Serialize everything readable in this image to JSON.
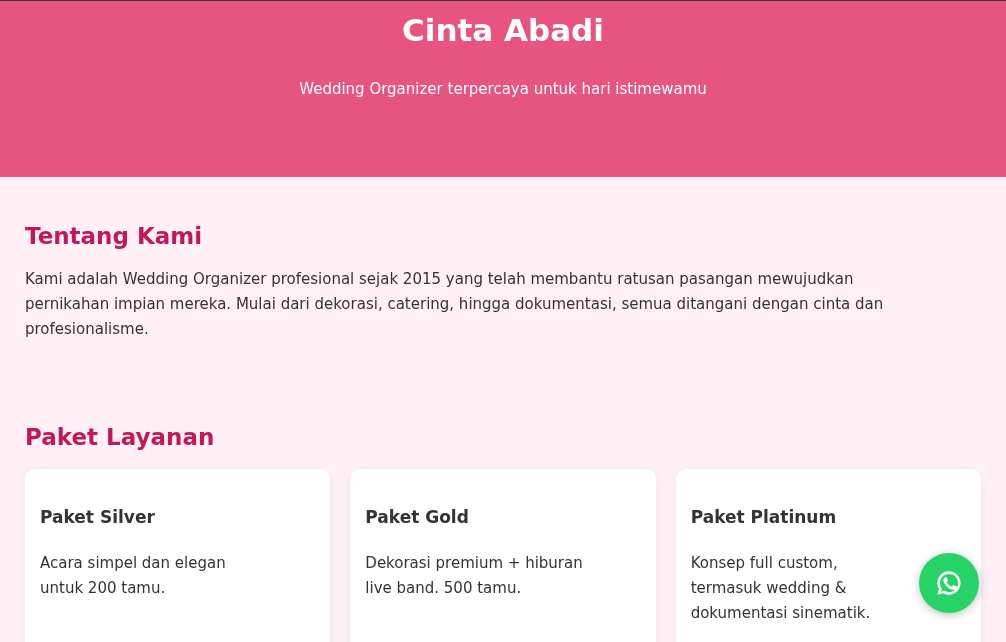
{
  "header": {
    "title": "Cinta Abadi",
    "tagline": "Wedding Organizer terpercaya untuk hari istimewamu"
  },
  "about": {
    "heading": "Tentang Kami",
    "text": "Kami adalah Wedding Organizer profesional sejak 2015 yang telah membantu ratusan pasangan mewujudkan pernikahan impian mereka. Mulai dari dekorasi, catering, hingga dokumentasi, semua ditangani dengan cinta dan profesionalisme."
  },
  "packages": {
    "heading": "Paket Layanan",
    "items": [
      {
        "name": "Paket Silver",
        "description": "Acara simpel dan elegan untuk 200 tamu."
      },
      {
        "name": "Paket Gold",
        "description": "Dekorasi premium + hiburan live band. 500 tamu."
      },
      {
        "name": "Paket Platinum",
        "description": "Konsep full custom, termasuk wedding & dokumentasi sinematik."
      }
    ]
  }
}
